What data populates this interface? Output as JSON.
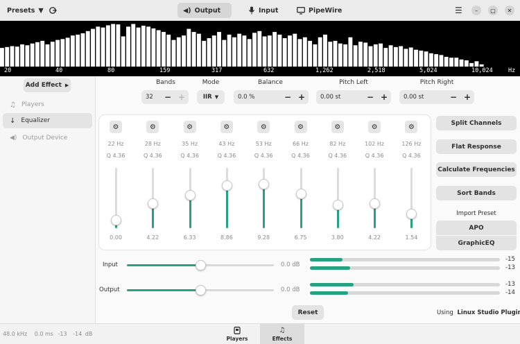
{
  "header": {
    "presets_label": "Presets",
    "tabs": [
      {
        "label": "Output",
        "active": true
      },
      {
        "label": "Input",
        "active": false
      },
      {
        "label": "PipeWire",
        "active": false
      }
    ]
  },
  "spectrum": {
    "freq_labels": [
      "20",
      "40",
      "80",
      "159",
      "317",
      "632",
      "1,262",
      "2,518",
      "5,024",
      "10,024",
      "Hz"
    ],
    "levels": [
      0.42,
      0.44,
      0.46,
      0.45,
      0.5,
      0.48,
      0.52,
      0.55,
      0.58,
      0.5,
      0.56,
      0.6,
      0.62,
      0.65,
      0.7,
      0.72,
      0.75,
      0.8,
      0.85,
      0.9,
      0.88,
      0.93,
      0.96,
      0.95,
      0.68,
      0.9,
      0.96,
      0.88,
      0.92,
      0.9,
      0.86,
      0.82,
      0.78,
      0.72,
      0.6,
      0.66,
      0.7,
      0.85,
      0.78,
      0.74,
      0.58,
      0.64,
      0.7,
      0.78,
      0.6,
      0.72,
      0.66,
      0.74,
      0.7,
      0.62,
      0.76,
      0.8,
      0.68,
      0.7,
      0.78,
      0.72,
      0.64,
      0.7,
      0.74,
      0.62,
      0.66,
      0.58,
      0.5,
      0.66,
      0.72,
      0.56,
      0.58,
      0.52,
      0.5,
      0.66,
      0.48,
      0.56,
      0.54,
      0.46,
      0.5,
      0.52,
      0.42,
      0.48,
      0.44,
      0.46,
      0.4,
      0.43,
      0.38,
      0.36,
      0.34,
      0.3,
      0.28,
      0.26,
      0.22,
      0.2,
      0.2,
      0.16,
      0.14,
      0.08,
      0.12,
      0.05,
      0.0,
      0.0,
      0.0,
      0.0,
      0.0,
      0.0,
      0.0
    ],
    "bar_color": "#ffffff"
  },
  "sidebar": {
    "add_effect_label": "Add Effect",
    "items": [
      {
        "label": "Players",
        "selected": false,
        "icon": "players-icon"
      },
      {
        "label": "Equalizer",
        "selected": true,
        "icon": "arrow-down-icon"
      },
      {
        "label": "Output Device",
        "selected": false,
        "icon": "speaker-icon"
      }
    ],
    "status": {
      "rate": "48.0 kHz",
      "latency": "0.0 ms",
      "left": "-13",
      "right": "-14",
      "unit": "dB"
    }
  },
  "controls": {
    "bands": {
      "label": "Bands",
      "value": "32"
    },
    "mode": {
      "label": "Mode",
      "value": "IIR"
    },
    "balance": {
      "label": "Balance",
      "value": "0.0 %"
    },
    "pitch_left": {
      "label": "Pitch Left",
      "value": "0.00 st"
    },
    "pitch_right": {
      "label": "Pitch Right",
      "value": "0.00 st"
    }
  },
  "bands": [
    {
      "freq": "22 Hz",
      "q": "Q 4.36",
      "value": "0.00",
      "level": 0.0
    },
    {
      "freq": "28 Hz",
      "q": "Q 4.36",
      "value": "4.22",
      "level": 4.22
    },
    {
      "freq": "35 Hz",
      "q": "Q 4.36",
      "value": "6.33",
      "level": 6.33
    },
    {
      "freq": "43 Hz",
      "q": "Q 4.36",
      "value": "8.86",
      "level": 8.86
    },
    {
      "freq": "53 Hz",
      "q": "Q 4.36",
      "value": "9.28",
      "level": 9.28
    },
    {
      "freq": "66 Hz",
      "q": "Q 4.36",
      "value": "6.75",
      "level": 6.75
    },
    {
      "freq": "82 Hz",
      "q": "Q 4.36",
      "value": "3.80",
      "level": 3.8
    },
    {
      "freq": "102 Hz",
      "q": "Q 4.36",
      "value": "4.22",
      "level": 4.22
    },
    {
      "freq": "126 Hz",
      "q": "Q 4.36",
      "value": "1.54",
      "level": 1.54
    }
  ],
  "right_panel": {
    "split_channels": "Split Channels",
    "flat_response": "Flat Response",
    "calculate_frequencies": "Calculate Frequencies",
    "sort_bands": "Sort Bands",
    "import_preset": "Import Preset",
    "apo": "APO",
    "graphiceq": "GraphicEQ"
  },
  "levels": {
    "input": {
      "label": "Input",
      "gain": "0.0 dB",
      "slider": 0.5,
      "meters": [
        {
          "value": "-15",
          "fill": 0.17
        },
        {
          "value": "-13",
          "fill": 0.21
        }
      ]
    },
    "output": {
      "label": "Output",
      "gain": "0.0 dB",
      "slider": 0.5,
      "meters": [
        {
          "value": "-13",
          "fill": 0.23
        },
        {
          "value": "-14",
          "fill": 0.2
        }
      ]
    }
  },
  "reset_label": "Reset",
  "using": {
    "prefix": "Using",
    "name": "Linux Studio Plugins"
  },
  "footer": {
    "tabs": [
      {
        "label": "Players",
        "selected": false
      },
      {
        "label": "Effects",
        "selected": true
      }
    ]
  },
  "colors": {
    "accent": "#26a281",
    "header_bg": "#ebebeb"
  }
}
